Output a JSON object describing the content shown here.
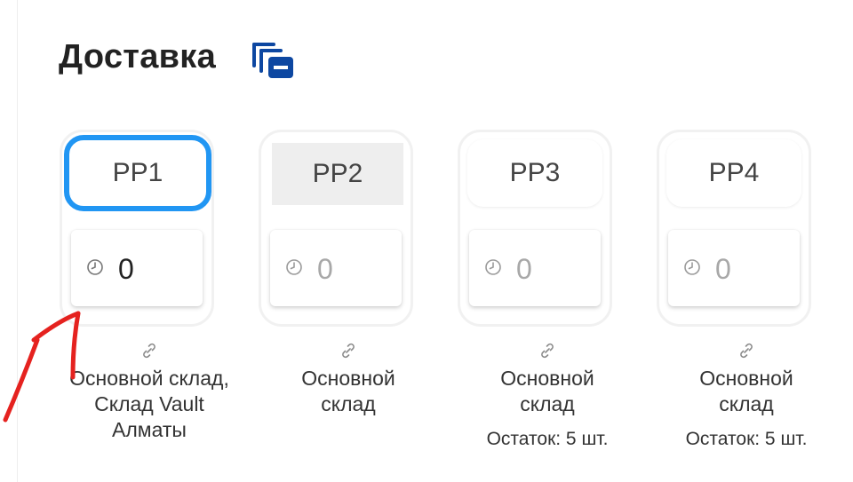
{
  "section": {
    "title": "Доставка",
    "copy_icon": "copy-icon"
  },
  "accent_color": "#2196f3",
  "icon_color": "#0d47a1",
  "cards": [
    {
      "name": "PP1",
      "count": "0",
      "state": "selected",
      "link_icon": "link-icon",
      "clock_icon": "clock-icon",
      "warehouse": "Основной склад, Склад Vault Алматы",
      "stock": ""
    },
    {
      "name": "PP2",
      "count": "0",
      "state": "hover",
      "link_icon": "link-icon",
      "clock_icon": "clock-icon",
      "warehouse": "Основной склад",
      "stock": ""
    },
    {
      "name": "PP3",
      "count": "0",
      "state": "normal",
      "link_icon": "link-icon",
      "clock_icon": "clock-icon",
      "warehouse": "Основной склад",
      "stock": "Остаток: 5 шт."
    },
    {
      "name": "PP4",
      "count": "0",
      "state": "normal",
      "link_icon": "link-icon",
      "clock_icon": "clock-icon",
      "warehouse": "Основной склад",
      "stock": "Остаток: 5 шт."
    }
  ],
  "annotation": {
    "icon": "red-arrow-annotation",
    "color": "#e5221f"
  }
}
